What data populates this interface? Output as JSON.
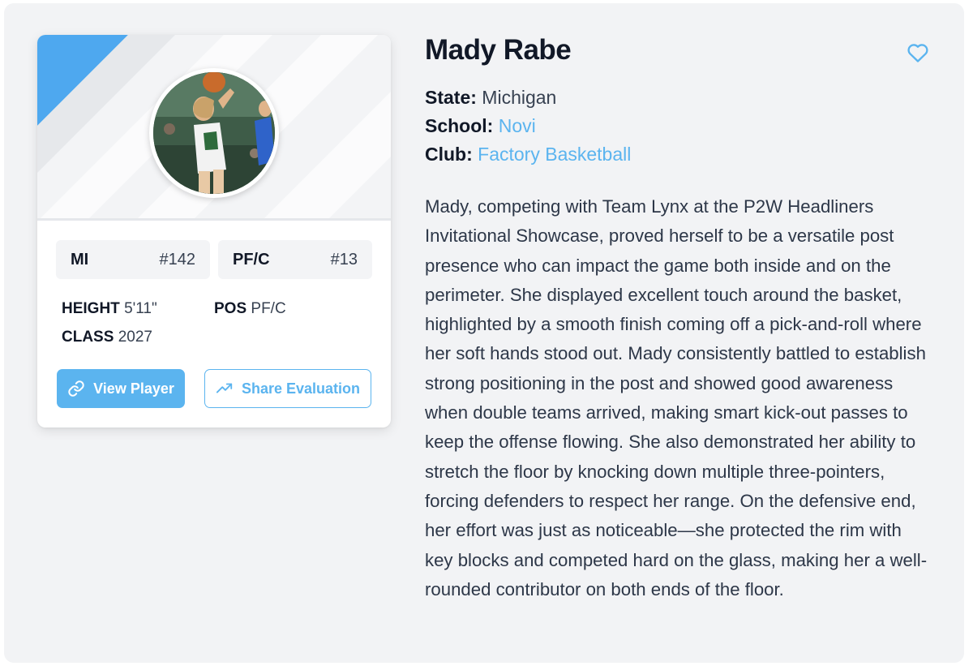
{
  "player": {
    "name": "Mady Rabe",
    "state_label": "State:",
    "state": "Michigan",
    "school_label": "School:",
    "school": "Novi",
    "club_label": "Club:",
    "club": "Factory Basketball",
    "bio": "Mady, competing with Team Lynx at the P2W Headliners Invitational Showcase, proved herself to be a versatile post presence who can impact the game both inside and on the perimeter. She displayed excellent touch around the basket, highlighted by a smooth finish coming off a pick-and-roll where her soft hands stood out. Mady consistently battled to establish strong positioning in the post and showed good awareness when double teams arrived, making smart kick-out passes to keep the offense flowing. She also demonstrated her ability to stretch the floor by knocking down multiple three-pointers, forcing defenders to respect her range. On the defensive end, her effort was just as noticeable—she protected the rim with key blocks and competed hard on the glass, making her a well-rounded contributor on both ends of the floor."
  },
  "card": {
    "tags": [
      {
        "key": "MI",
        "value": "#142"
      },
      {
        "key": "PF/C",
        "value": "#13"
      }
    ],
    "stats": {
      "height_label": "HEIGHT",
      "height": "5'11\"",
      "pos_label": "POS",
      "pos": "PF/C",
      "class_label": "CLASS",
      "class": "2027"
    },
    "buttons": {
      "view_player": "View Player",
      "share_evaluation": "Share Evaluation"
    },
    "icons": {
      "view": "link-icon",
      "share": "trending-up-icon",
      "favorite": "heart-icon"
    }
  },
  "colors": {
    "accent": "#5bb4ef",
    "panel": "#f2f3f5",
    "text_dark": "#111827"
  }
}
